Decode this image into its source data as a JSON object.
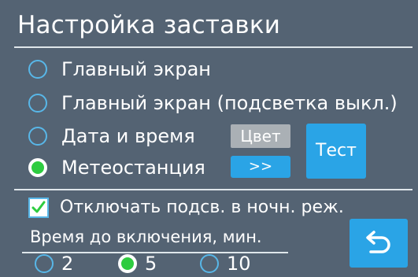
{
  "screen": {
    "title": "Настройка заставки"
  },
  "modes": [
    {
      "label": "Главный экран",
      "checked": false
    },
    {
      "label": "Главный экран (подсветка выкл.)",
      "checked": false
    },
    {
      "label": "Дата и время",
      "checked": false
    },
    {
      "label": "Метеостанция",
      "checked": true
    }
  ],
  "buttons": {
    "color_label": "Цвет",
    "next_label": ">>",
    "test_label": "Тест"
  },
  "night_mode": {
    "label": "Отключать подсв. в ночн. реж.",
    "checked": true
  },
  "delay": {
    "label": "Время до включения, мин.",
    "options": [
      {
        "label": "2",
        "checked": false
      },
      {
        "label": "5",
        "checked": true
      },
      {
        "label": "10",
        "checked": false
      }
    ]
  },
  "icons": {
    "back": "back-arrow-icon",
    "check": "check-icon"
  },
  "colors": {
    "background": "#546373",
    "accent_blue": "#2aa4e6",
    "radio_ring": "#58b7e8",
    "selected_green": "#2ecc40",
    "button_gray": "#aab0b5"
  }
}
